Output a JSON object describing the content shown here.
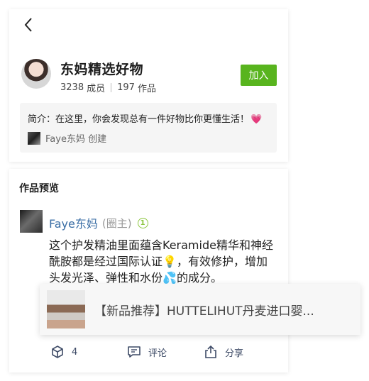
{
  "header": {
    "back_icon": "chevron-left-icon"
  },
  "group": {
    "name": "东妈精选好物",
    "member_count": "3238",
    "member_label": "成员",
    "works_count": "197",
    "works_label": "作品",
    "join_label": "加入",
    "intro_label": "简介：",
    "intro_text": "在这里，你会发现总有一件好物比你更懂生活！",
    "intro_emoji": "💗",
    "creator_name": "Faye东妈",
    "creator_suffix": "创建"
  },
  "preview": {
    "section_title": "作品预览",
    "author_name": "Faye东妈",
    "author_role": "(圈主)",
    "author_level": "1",
    "post_text_1": "这个护发精油里面蕴含Keramide精华和神经酰胺都是经过国际认证",
    "post_emoji_bulb": "💡",
    "post_text_2": "，有效修护，增加头发光泽、弹性和水份",
    "post_emoji_drops": "💦",
    "post_text_3": "的成分。",
    "product_title": "【新品推荐】HUTTELIHUT丹麦进口婴..."
  },
  "actions": {
    "like_count": "4",
    "comment_label": "评论",
    "share_label": "分享"
  },
  "colors": {
    "join_green": "#58b41e",
    "author_blue": "#3a6ea5",
    "level_green": "#8cc63f",
    "action_navy": "#3d4a66"
  }
}
